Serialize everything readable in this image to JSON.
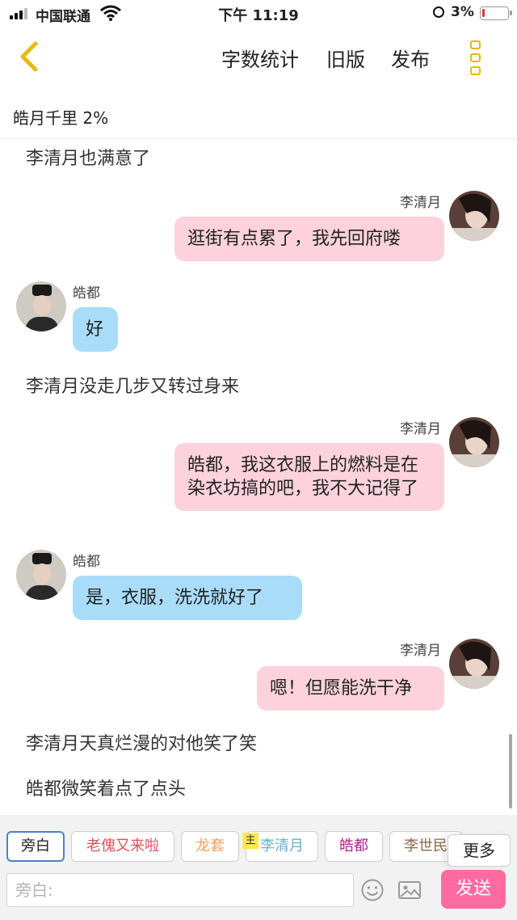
{
  "status_bar": {
    "carrier": "中国联通",
    "time": "下午 11:19",
    "battery": "3%"
  },
  "nav": {
    "back_icon": "chevron-left-icon",
    "word_count": "字数统计",
    "old_version": "旧版",
    "publish": "发布",
    "more_icon": "menu-icon",
    "accent": "#e8b90f"
  },
  "story_title": "皓月千里 2%",
  "messages": [
    {
      "type": "narration",
      "text": "李清月也满意了"
    },
    {
      "type": "right",
      "speaker": "李清月",
      "text": "逛街有点累了，我先回府喽"
    },
    {
      "type": "left",
      "speaker": "皓都",
      "text": "好"
    },
    {
      "type": "narration",
      "text": "李清月没走几步又转过身来"
    },
    {
      "type": "right",
      "speaker": "李清月",
      "text": "皓都，我这衣服上的燃料是在染衣坊搞的吧，我不大记得了"
    },
    {
      "type": "left",
      "speaker": "皓都",
      "text": "是，衣服，洗洗就好了"
    },
    {
      "type": "right",
      "speaker": "李清月",
      "text": "嗯！但愿能洗干净"
    },
    {
      "type": "narration",
      "text": "李清月天真烂漫的对他笑了笑"
    },
    {
      "type": "narration",
      "text": "皓都微笑着点了点头"
    }
  ],
  "roles": {
    "tabs": [
      {
        "label": "旁白",
        "color": "#222222"
      },
      {
        "label": "老傀又来啦",
        "color": "#e0505a"
      },
      {
        "label": "龙套",
        "color": "#f0a060"
      },
      {
        "label": "李清月",
        "color": "#6ab0c8"
      },
      {
        "label": "皓都",
        "color": "#b02090"
      },
      {
        "label": "李世民",
        "color": "#8a6a4a"
      }
    ],
    "owner_badge": "主",
    "more": "更多"
  },
  "composer": {
    "placeholder": "旁白:",
    "send": "发送",
    "emoji_icon": "smiley-icon",
    "image_icon": "image-icon"
  },
  "colors": {
    "right_bubble": "#fdd2dc",
    "left_bubble": "#a9dcf9",
    "send_button": "#ff6aa0"
  }
}
